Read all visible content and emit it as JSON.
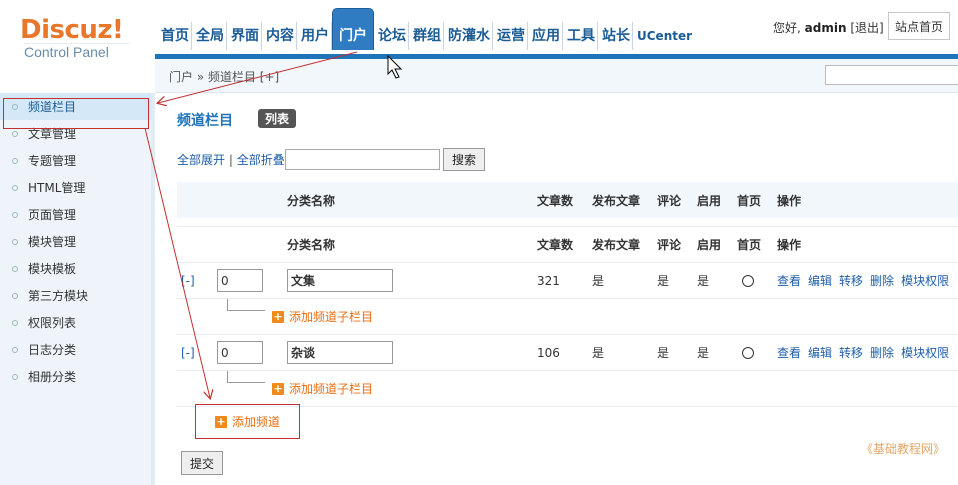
{
  "logo": {
    "word": "Discuz!",
    "subtitle": "Control Panel"
  },
  "nav": {
    "items": [
      "首页",
      "全局",
      "界面",
      "内容",
      "用户",
      "门户",
      "论坛",
      "群组",
      "防灌水",
      "运营",
      "应用",
      "工具",
      "站长",
      "UCenter"
    ],
    "active": "门户"
  },
  "user": {
    "greeting": "您好,",
    "name": "admin",
    "logout": "[退出]",
    "site_home": "站点首页"
  },
  "breadcrumb": "门户 » 频道栏目  [+]",
  "sidebar": {
    "items": [
      "频道栏目",
      "文章管理",
      "专题管理",
      "HTML管理",
      "页面管理",
      "模块管理",
      "模块模板",
      "第三方模块",
      "权限列表",
      "日志分类",
      "相册分类"
    ],
    "active": "频道栏目"
  },
  "main": {
    "title": "频道栏目",
    "list_badge": "列表",
    "expand_all": "全部展开",
    "separator": "|",
    "collapse_all": "全部折叠",
    "search_button": "搜索",
    "columns": [
      "分类名称",
      "文章数",
      "发布文章",
      "评论",
      "启用",
      "首页",
      "操作"
    ],
    "rows": [
      {
        "toggle": "[-]",
        "order": "0",
        "name": "文集",
        "count": "321",
        "publish": "是",
        "comment": "是",
        "enabled": "是",
        "add_child": "添加频道子栏目"
      },
      {
        "toggle": "[-]",
        "order": "0",
        "name": "杂谈",
        "count": "106",
        "publish": "是",
        "comment": "是",
        "enabled": "是",
        "add_child": "添加频道子栏目"
      }
    ],
    "ops": [
      "查看",
      "编辑",
      "转移",
      "删除",
      "模块权限"
    ],
    "add_channel": "添加频道",
    "submit": "提交"
  },
  "watermark": "《基础教程网》",
  "colors": {
    "nav_blue": "#1f73b9",
    "link": "#1f5ea8",
    "orange": "#e86d10",
    "annotation": "#c23030"
  }
}
